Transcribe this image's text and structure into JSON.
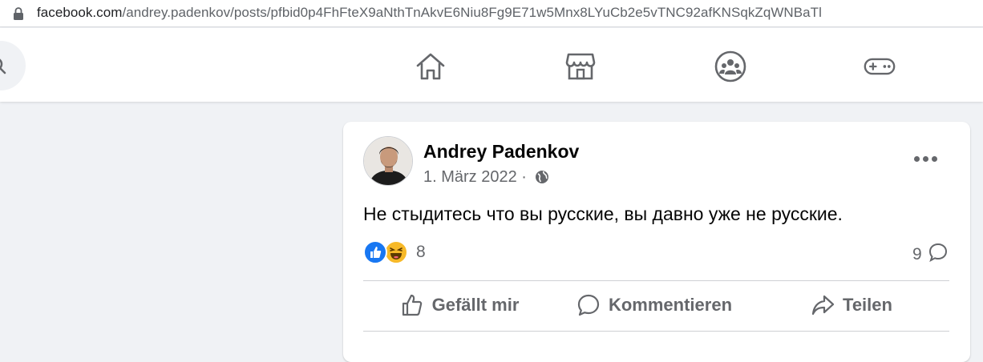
{
  "browser": {
    "url_domain": "facebook.com",
    "url_path": "/andrey.padenkov/posts/pfbid0p4FhFteX9aNthTnAkvE6Niu8Fg9E71w5Mnx8LYuCb2e5vTNC92afKNSqkZqWNBaTl"
  },
  "nav": {
    "icons": [
      "home-icon",
      "marketplace-icon",
      "groups-icon",
      "gaming-icon"
    ]
  },
  "post": {
    "author": "Andrey Padenkov",
    "date": "1. März 2022 ·",
    "text": "Не стыдитесь что вы русские, вы давно уже не русские.",
    "reaction_count": "8",
    "comment_count": "9"
  },
  "actions": {
    "like": "Gefällt mir",
    "comment": "Kommentieren",
    "share": "Teilen"
  },
  "colors": {
    "icon_gray": "#65676b",
    "like_blue": "#1877f2",
    "haha_yellow": "#f7b928",
    "page_bg": "#f0f2f5"
  }
}
